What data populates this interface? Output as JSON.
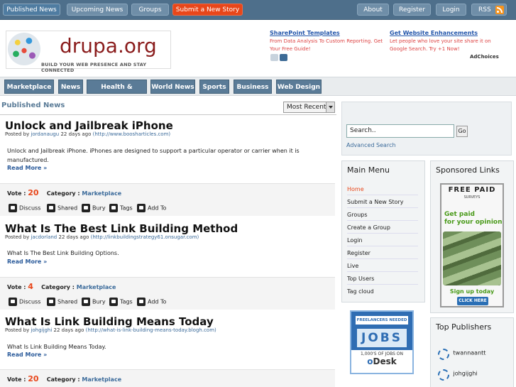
{
  "topnav": {
    "left": [
      "Published News",
      "Upcoming News",
      "Groups",
      "Submit a New Story"
    ],
    "right": [
      "About",
      "Register",
      "Login",
      "RSS"
    ]
  },
  "logo": {
    "name": "drupa.org",
    "tagline": "BUILD YOUR WEB PRESENCE AND STAY CONNECTED"
  },
  "header_ad": {
    "ad1_title": "SharePoint Templates",
    "ad1_body": "From Data Analysis To Custom Reporting. Get Your Free Guide!",
    "ad2_title": "Get Website Enhancements",
    "ad2_body": "Let people who love your site share it on Google Search. Try +1 Now!",
    "adchoices": "AdChoices"
  },
  "categories": [
    "Marketplace",
    "News",
    "Health & Fitness",
    "World News",
    "Sports",
    "Business",
    "Web Design"
  ],
  "section_title": "Published News",
  "sort_value": "Most Recent",
  "stories": [
    {
      "title": "Unlock and Jailbreak iPhone",
      "posted_by": "Posted by",
      "author": "jordanaugu",
      "age": "22 days ago",
      "url": "(http://www.boosharticles.com)",
      "desc": "Unlock and Jailbreak iPhone. iPhones are designed to support a particular operator or carrier when it is manufactured.",
      "read_more": "Read More »",
      "vote_label": "Vote :",
      "votes": "20",
      "cat_label": "Category :",
      "category": "Marketplace"
    },
    {
      "title": "What Is The Best Link Building Method",
      "posted_by": "Posted by",
      "author": "jacdorland",
      "age": "22 days ago",
      "url": "(http://linkbuildingstrategy61.onsugar.com)",
      "desc": "What Is The Best Link Building Options.",
      "read_more": "Read More »",
      "vote_label": "Vote :",
      "votes": "4",
      "cat_label": "Category :",
      "category": "Marketplace"
    },
    {
      "title": "What Is Link Building Means Today",
      "posted_by": "Posted by",
      "author": "johgijghi",
      "age": "22 days ago",
      "url": "(http://what-is-link-building-means-today.blogh.com)",
      "desc": "What Is Link Building Means Today.",
      "read_more": "Read More »",
      "vote_label": "Vote :",
      "votes": "20",
      "cat_label": "Category :",
      "category": "Marketplace"
    }
  ],
  "actions": [
    "Discuss",
    "Shared",
    "Bury",
    "Tags",
    "Add To"
  ],
  "search": {
    "value": "Search..",
    "go": "Go",
    "advanced": "Advanced Search"
  },
  "main_menu": {
    "title": "Main Menu",
    "items": [
      "Home",
      "Submit a New Story",
      "Groups",
      "Create a Group",
      "Login",
      "Register",
      "Live",
      "Top Users",
      "Tag cloud"
    ]
  },
  "sponsored": {
    "title": "Sponsored Links",
    "ad_top": "FREE PAID",
    "ad_sub": "SURVEYS",
    "ad_main1": "Get paid",
    "ad_main2": "for your opinion",
    "ad_signup": "Sign up today",
    "ad_click": "CLICK HERE"
  },
  "odesk": {
    "top": "FREELANCERS NEEDED",
    "jobs": "JOBS",
    "count": "1,000'S OF JOBS ON",
    "logo_o": "o",
    "logo_rest": "Desk"
  },
  "top_publishers": {
    "title": "Top Publishers",
    "items": [
      "twannaantt",
      "johgijghi"
    ]
  },
  "colors": {
    "nav": "#4e6f8b",
    "accent": "#e8461a",
    "link": "#3a6a9a",
    "category_btn": "#5a7b97"
  }
}
